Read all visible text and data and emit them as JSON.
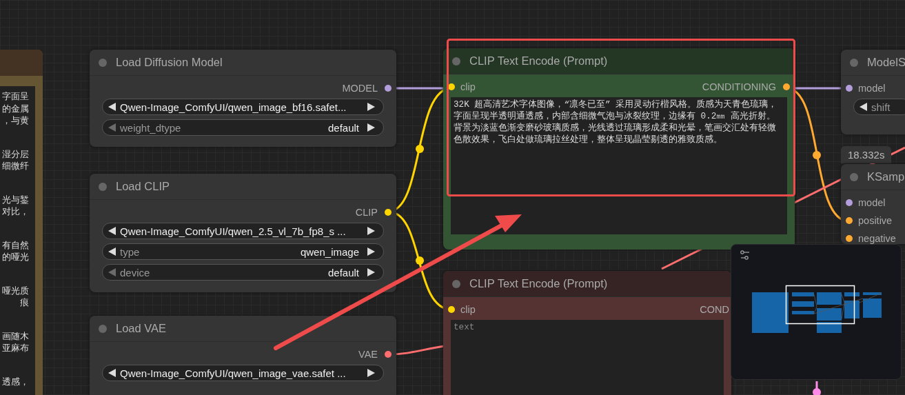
{
  "note": {
    "paragraphs": [
      {
        "lines": [
          "字面呈",
          "的金属",
          "，与黄"
        ]
      },
      {
        "lines": [
          "湿分层",
          "细微纤"
        ]
      },
      {
        "lines": [
          "光与錾",
          "对比，"
        ]
      },
      {
        "lines": [
          "有自然",
          "的哑光"
        ]
      },
      {
        "lines": [
          "哑光质",
          "痕"
        ]
      },
      {
        "lines": [
          "画随木",
          "亚麻布"
        ]
      },
      {
        "lines": [
          "透感，"
        ]
      }
    ]
  },
  "nodes": [
    {
      "kind": "loader",
      "title": "Load Diffusion Model",
      "outputs": [
        {
          "label": "MODEL",
          "color": "#b39ddb"
        }
      ],
      "widgets": [
        {
          "value": "Qwen-Image_ComfyUI/qwen_image_bf16.safet...",
          "prev_enabled": true
        },
        {
          "label": "weight_dtype",
          "value": "default",
          "prev_enabled": false
        }
      ]
    },
    {
      "kind": "loader",
      "title": "Load CLIP",
      "outputs": [
        {
          "label": "CLIP",
          "color": "#ffd500"
        }
      ],
      "widgets": [
        {
          "value": "Qwen-Image_ComfyUI/qwen_2.5_vl_7b_fp8_s ...",
          "prev_enabled": true
        },
        {
          "label": "type",
          "value": "qwen_image",
          "prev_enabled": true
        },
        {
          "label": "device",
          "value": "default",
          "prev_enabled": false
        }
      ]
    },
    {
      "kind": "loader",
      "title": "Load VAE",
      "outputs": [
        {
          "label": "VAE",
          "color": "#ff6e6e"
        }
      ],
      "widgets": [
        {
          "value": "Qwen-Image_ComfyUI/qwen_image_vae.safet ...",
          "prev_enabled": true
        }
      ]
    },
    {
      "kind": "encoder",
      "title": "CLIP Text Encode (Prompt)",
      "color": "#335533",
      "inputs": [
        {
          "label": "clip",
          "color": "#ffd500"
        }
      ],
      "outputs": [
        {
          "label": "CONDITIONING",
          "color": "#ffa931"
        }
      ],
      "text": "32K 超高清艺术字体图像，“凛冬已至” 采用灵动行楷风格。质感为天青色琉璃，字面呈现半透明通透感，内部含细微气泡与冰裂纹理，边缘有 0.2㎜ 高光折射。背景为淡蓝色渐变磨砂玻璃质感，光线透过琉璃形成柔和光晕，笔画交汇处有轻微色散效果，飞白处做琉璃拉丝处理，整体呈现晶莹剔透的雅致质感。"
    },
    {
      "kind": "encoder",
      "title": "CLIP Text Encode (Prompt)",
      "color": "#553333",
      "inputs": [
        {
          "label": "clip",
          "color": "#ffd500"
        }
      ],
      "outputs": [
        {
          "label": "COND"
        }
      ],
      "placeholder": "text"
    },
    {
      "kind": "partial",
      "title": "ModelS",
      "inputs": [
        {
          "label": "model",
          "color": "#b39ddb"
        }
      ],
      "widgets": [
        {
          "label": "shift",
          "prev_enabled": true
        }
      ]
    },
    {
      "kind": "partial",
      "title": "KSamp",
      "inputs": [
        {
          "label": "model",
          "color": "#b39ddb"
        },
        {
          "label": "positive",
          "color": "#ffa931"
        },
        {
          "label": "negative",
          "color": "#ffa931"
        }
      ]
    }
  ],
  "execution_time": "18.332s"
}
